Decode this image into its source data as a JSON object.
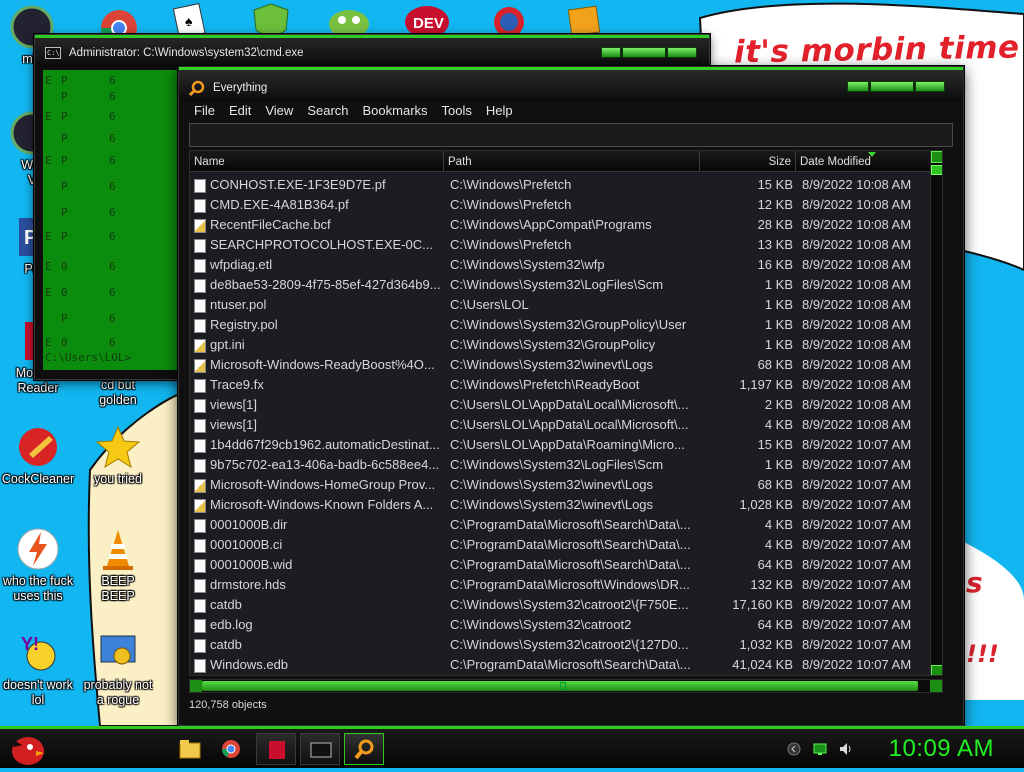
{
  "desktop": {
    "wallpaper_text": "it's morbin time",
    "scrawl_1": "s",
    "scrawl_2": "!!!",
    "icons_left": [
      {
        "label": "mis"
      },
      {
        "label": "Win\nV"
      },
      {
        "label": "Po"
      },
      {
        "label": "Morbius\nReader"
      },
      {
        "label": "CockCleaner"
      },
      {
        "label": "who the fuck\nuses this"
      },
      {
        "label": "doesn't work\nlol"
      }
    ],
    "icons_right": [
      {
        "label": "cd but\ngolden"
      },
      {
        "label": "you tried"
      },
      {
        "label": "BEEP\nBEEP"
      },
      {
        "label": "probably not\na rogue"
      }
    ],
    "top_icon_text": "DEV"
  },
  "cmd_window": {
    "title": "Administrator: C:\\Windows\\system32\\cmd.exe",
    "prompt": "C:\\Users\\LOL>"
  },
  "everything_window": {
    "title": "Everything",
    "menu": [
      "File",
      "Edit",
      "View",
      "Search",
      "Bookmarks",
      "Tools",
      "Help"
    ],
    "search_value": "",
    "columns": {
      "name": "Name",
      "path": "Path",
      "size": "Size",
      "date": "Date Modified"
    },
    "rows": [
      {
        "name": "CONHOST.EXE-1F3E9D7E.pf",
        "path": "C:\\Windows\\Prefetch",
        "size": "15 KB",
        "date": "8/9/2022 10:08 AM",
        "icon": "file"
      },
      {
        "name": "CMD.EXE-4A81B364.pf",
        "path": "C:\\Windows\\Prefetch",
        "size": "12 KB",
        "date": "8/9/2022 10:08 AM",
        "icon": "file"
      },
      {
        "name": "RecentFileCache.bcf",
        "path": "C:\\Windows\\AppCompat\\Programs",
        "size": "28 KB",
        "date": "8/9/2022 10:08 AM",
        "icon": "sys"
      },
      {
        "name": "SEARCHPROTOCOLHOST.EXE-0C...",
        "path": "C:\\Windows\\Prefetch",
        "size": "13 KB",
        "date": "8/9/2022 10:08 AM",
        "icon": "file"
      },
      {
        "name": "wfpdiag.etl",
        "path": "C:\\Windows\\System32\\wfp",
        "size": "16 KB",
        "date": "8/9/2022 10:08 AM",
        "icon": "file"
      },
      {
        "name": "de8bae53-2809-4f75-85ef-427d364b9...",
        "path": "C:\\Windows\\System32\\LogFiles\\Scm",
        "size": "1 KB",
        "date": "8/9/2022 10:08 AM",
        "icon": "file"
      },
      {
        "name": "ntuser.pol",
        "path": "C:\\Users\\LOL",
        "size": "1 KB",
        "date": "8/9/2022 10:08 AM",
        "icon": "file"
      },
      {
        "name": "Registry.pol",
        "path": "C:\\Windows\\System32\\GroupPolicy\\User",
        "size": "1 KB",
        "date": "8/9/2022 10:08 AM",
        "icon": "file"
      },
      {
        "name": "gpt.ini",
        "path": "C:\\Windows\\System32\\GroupPolicy",
        "size": "1 KB",
        "date": "8/9/2022 10:08 AM",
        "icon": "sys"
      },
      {
        "name": "Microsoft-Windows-ReadyBoost%4O...",
        "path": "C:\\Windows\\System32\\winevt\\Logs",
        "size": "68 KB",
        "date": "8/9/2022 10:08 AM",
        "icon": "sys"
      },
      {
        "name": "Trace9.fx",
        "path": "C:\\Windows\\Prefetch\\ReadyBoot",
        "size": "1,197 KB",
        "date": "8/9/2022 10:08 AM",
        "icon": "file"
      },
      {
        "name": "views[1]",
        "path": "C:\\Users\\LOL\\AppData\\Local\\Microsoft\\...",
        "size": "2 KB",
        "date": "8/9/2022 10:08 AM",
        "icon": "file"
      },
      {
        "name": "views[1]",
        "path": "C:\\Users\\LOL\\AppData\\Local\\Microsoft\\...",
        "size": "4 KB",
        "date": "8/9/2022 10:08 AM",
        "icon": "file"
      },
      {
        "name": "1b4dd67f29cb1962.automaticDestinat...",
        "path": "C:\\Users\\LOL\\AppData\\Roaming\\Micro...",
        "size": "15 KB",
        "date": "8/9/2022 10:07 AM",
        "icon": "file"
      },
      {
        "name": "9b75c702-ea13-406a-badb-6c588ee4...",
        "path": "C:\\Windows\\System32\\LogFiles\\Scm",
        "size": "1 KB",
        "date": "8/9/2022 10:07 AM",
        "icon": "file"
      },
      {
        "name": "Microsoft-Windows-HomeGroup Prov...",
        "path": "C:\\Windows\\System32\\winevt\\Logs",
        "size": "68 KB",
        "date": "8/9/2022 10:07 AM",
        "icon": "sys"
      },
      {
        "name": "Microsoft-Windows-Known Folders A...",
        "path": "C:\\Windows\\System32\\winevt\\Logs",
        "size": "1,028 KB",
        "date": "8/9/2022 10:07 AM",
        "icon": "sys"
      },
      {
        "name": "0001000B.dir",
        "path": "C:\\ProgramData\\Microsoft\\Search\\Data\\...",
        "size": "4 KB",
        "date": "8/9/2022 10:07 AM",
        "icon": "file"
      },
      {
        "name": "0001000B.ci",
        "path": "C:\\ProgramData\\Microsoft\\Search\\Data\\...",
        "size": "4 KB",
        "date": "8/9/2022 10:07 AM",
        "icon": "file"
      },
      {
        "name": "0001000B.wid",
        "path": "C:\\ProgramData\\Microsoft\\Search\\Data\\...",
        "size": "64 KB",
        "date": "8/9/2022 10:07 AM",
        "icon": "file"
      },
      {
        "name": "drmstore.hds",
        "path": "C:\\ProgramData\\Microsoft\\Windows\\DR...",
        "size": "132 KB",
        "date": "8/9/2022 10:07 AM",
        "icon": "file"
      },
      {
        "name": "catdb",
        "path": "C:\\Windows\\System32\\catroot2\\{F750E...",
        "size": "17,160 KB",
        "date": "8/9/2022 10:07 AM",
        "icon": "file"
      },
      {
        "name": "edb.log",
        "path": "C:\\Windows\\System32\\catroot2",
        "size": "64 KB",
        "date": "8/9/2022 10:07 AM",
        "icon": "file"
      },
      {
        "name": "catdb",
        "path": "C:\\Windows\\System32\\catroot2\\{127D0...",
        "size": "1,032 KB",
        "date": "8/9/2022 10:07 AM",
        "icon": "file"
      },
      {
        "name": "Windows.edb",
        "path": "C:\\ProgramData\\Microsoft\\Search\\Data\\...",
        "size": "41,024 KB",
        "date": "8/9/2022 10:07 AM",
        "icon": "file"
      }
    ],
    "status": "120,758 objects"
  },
  "taskbar": {
    "clock": "10:09 AM",
    "accent": "#2ecb22"
  }
}
